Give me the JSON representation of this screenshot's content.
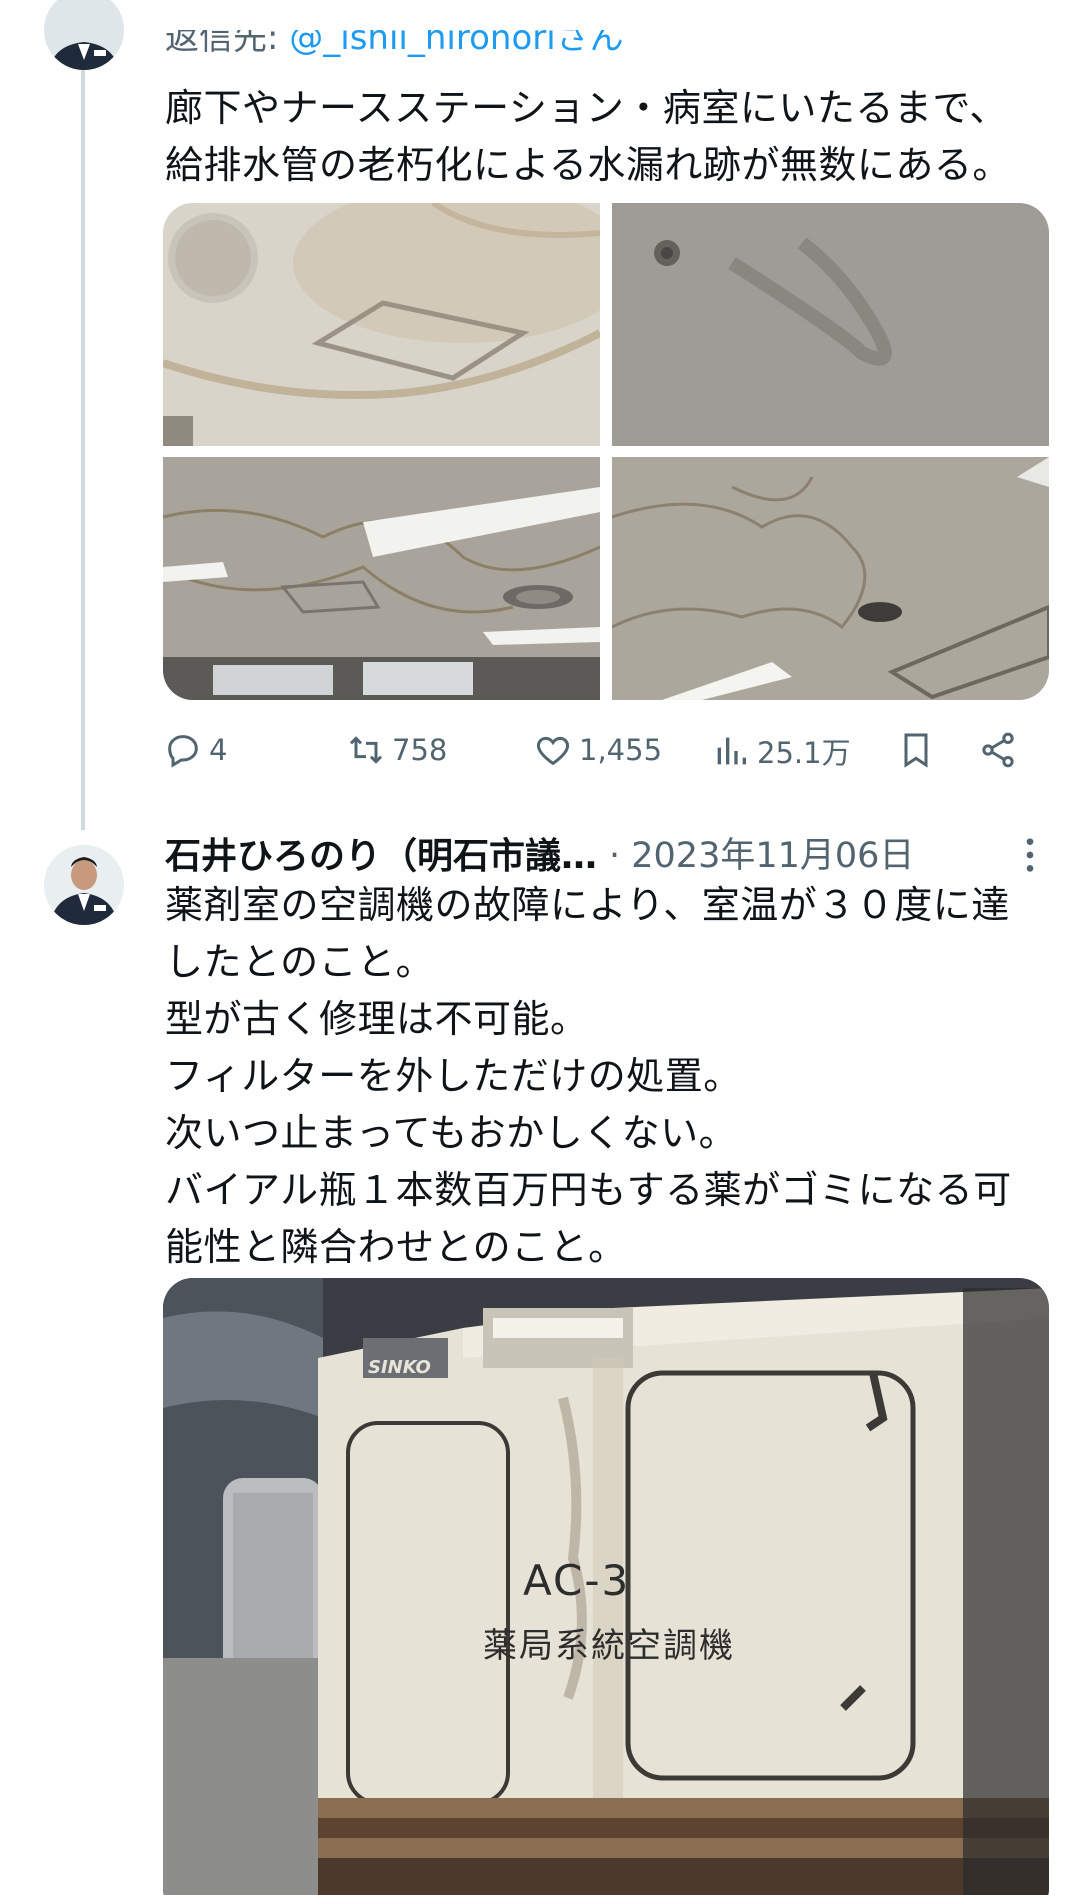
{
  "tweet1": {
    "reply_prefix": "返信先: ",
    "reply_handle": "@_ishii_hironoriさん",
    "text": "廊下やナースステーション・病室にいたるまで、\n給排水管の老朽化による水漏れ跡が無数にある。",
    "actions": {
      "replies": "4",
      "retweets": "758",
      "likes": "1,455",
      "views": "25.1万"
    }
  },
  "tweet2": {
    "author_name": "石井ひろのり（明石市議…",
    "meta": "· 2023年11月06日",
    "text": "薬剤室の空調機の故障により、室温が３０度に達\nしたとのこと。\n型が古く修理は不可能。\nフィルターを外しただけの処置。\n次いつ止まってもおかしくない。\nバイアル瓶１本数百万円もする薬がゴミになる可\n能性と隣合わせとのこと。",
    "photo_text": {
      "brand": "SINKO",
      "unit_code": "AC-3",
      "unit_name": "薬局系統空調機"
    }
  },
  "icons": {
    "reply": "reply-icon",
    "retweet": "retweet-icon",
    "like": "heart-icon",
    "views": "views-icon",
    "bookmark": "bookmark-icon",
    "share": "share-icon",
    "more": "more-icon"
  },
  "colors": {
    "text": "#0f1419",
    "secondary": "#536471",
    "link": "#1d9bf0",
    "thread_line": "#cfd9de"
  }
}
